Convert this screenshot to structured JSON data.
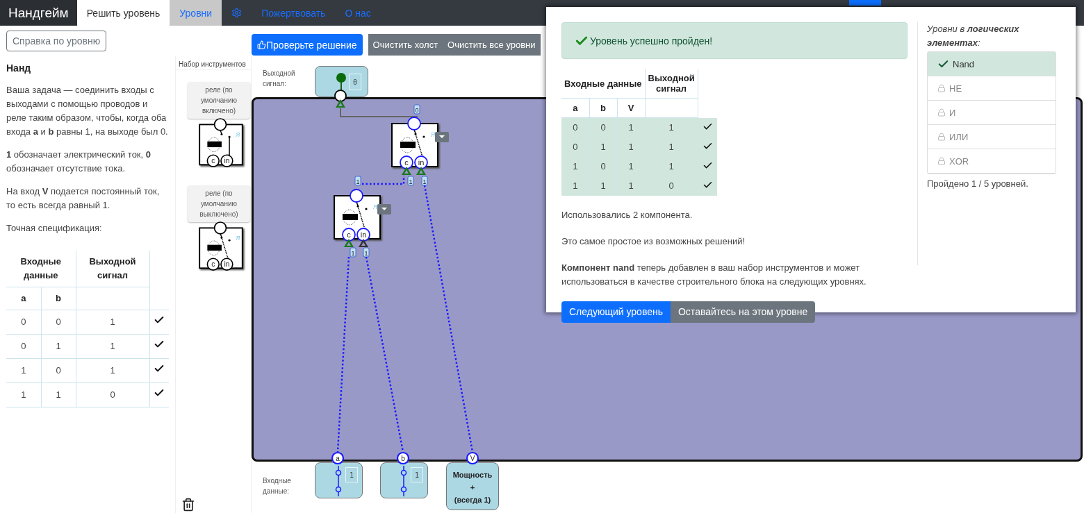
{
  "navbar": {
    "brand": "Нандгейм",
    "items": [
      {
        "kind": "text",
        "label": "Решить уровень",
        "selected": true,
        "highlighted": false
      },
      {
        "kind": "text",
        "label": "Уровни",
        "selected": false,
        "highlighted": true
      },
      {
        "kind": "settings",
        "selected": false,
        "highlighted": false
      },
      {
        "kind": "text",
        "label": "Пожертвовать",
        "selected": false,
        "highlighted": false
      },
      {
        "kind": "text",
        "label": "О нас",
        "selected": false,
        "highlighted": false
      },
      {
        "kind": "blank",
        "selected": true
      }
    ]
  },
  "sidebar": {
    "help_button": "Справка по уровню",
    "title": "Нанд",
    "paragraphs": [
      "Ваша задача — соединить входы с выходами с помощью проводов и реле таким образом, чтобы, когда оба входа **a** и **b** равны 1, на выходе был 0.",
      "**1** обозначает электрический ток, **0** обозначает отсутствие тока.",
      "На вход **V** подается постоянный ток, то есть всегда равный 1.",
      "Точная спецификация:"
    ],
    "spec_table": {
      "group_headers": [
        "Входные данные",
        "Выходной сигнал"
      ],
      "columns": [
        "a",
        "b"
      ],
      "rows": [
        {
          "cells": [
            "0",
            "0",
            "1"
          ],
          "passed": true
        },
        {
          "cells": [
            "0",
            "1",
            "1"
          ],
          "passed": true
        },
        {
          "cells": [
            "1",
            "0",
            "1"
          ],
          "passed": true
        },
        {
          "cells": [
            "1",
            "1",
            "0"
          ],
          "passed": true
        }
      ]
    }
  },
  "toolbar": {
    "check_button": "Проверьте решение",
    "buttons": [
      "Очистить холст",
      "Очистить все уровни"
    ]
  },
  "toolbox": {
    "title": "Набор инструментов",
    "items": [
      {
        "label": "реле (по умолчанию включено)",
        "default_on": true,
        "flip_mark": "Я",
        "pins": [
          "c",
          "in"
        ]
      },
      {
        "label": "реле (по умолчанию выключено)",
        "default_on": false,
        "flip_mark": "Я",
        "pins": [
          "c",
          "in"
        ]
      }
    ]
  },
  "circuit": {
    "output": {
      "label": "Выходной сигнал:",
      "lamp_on": true,
      "value": "0",
      "powered": true
    },
    "relays": [
      {
        "default_on": false,
        "flip_mark": "Я",
        "pins": [
          {
            "label": "c",
            "powered": true
          },
          {
            "label": "in",
            "powered": true
          }
        ]
      },
      {
        "default_on": false,
        "flip_mark": "Я",
        "pins": [
          {
            "label": "c",
            "powered": true
          },
          {
            "label": "in",
            "powered": false
          }
        ]
      }
    ],
    "wires": [
      {
        "value": "0",
        "active": false
      },
      {
        "value": "1",
        "end_value": "1",
        "active": true
      },
      {
        "value": "1",
        "active": true
      },
      {
        "value": "1",
        "active": true
      },
      {
        "value": "1",
        "active": true
      }
    ],
    "inputs_label": "Входные данные:",
    "inputs": [
      {
        "pin": "a",
        "value": "1",
        "on": true
      },
      {
        "pin": "b",
        "value": "1",
        "on": true
      }
    ],
    "power": {
      "pin": "V",
      "title": "Мощность",
      "plus": "+",
      "note": "(всегда 1)"
    }
  },
  "modal": {
    "alert": "Уровень успешно пройден!",
    "table": {
      "headers": [
        "Входные данные",
        "Выходной сигнал"
      ],
      "columns": [
        "a",
        "b",
        "V"
      ],
      "rows": [
        {
          "cells": [
            "0",
            "0",
            "1",
            "1"
          ],
          "passed": true
        },
        {
          "cells": [
            "0",
            "1",
            "1",
            "1"
          ],
          "passed": true
        },
        {
          "cells": [
            "1",
            "0",
            "1",
            "1"
          ],
          "passed": true
        },
        {
          "cells": [
            "1",
            "1",
            "1",
            "0"
          ],
          "passed": true
        }
      ]
    },
    "paragraphs": [
      "Использовались 2 компонента.",
      "Это самое простое из возможных решений!",
      "**Компонент nand** теперь добавлен в ваш набор инструментов и может использоваться в качестве строительного блока на следующих уровнях."
    ],
    "buttons": [
      "Следующий уровень",
      "Оставайтесь на этом уровне"
    ],
    "levels_title": "Уровни в **логических элементах**:",
    "levels": [
      {
        "label": "Nand",
        "selected": true,
        "locked": false
      },
      {
        "label": "НЕ",
        "selected": false,
        "locked": true
      },
      {
        "label": "И",
        "selected": false,
        "locked": true
      },
      {
        "label": "ИЛИ",
        "selected": false,
        "locked": true
      },
      {
        "label": "XOR",
        "selected": false,
        "locked": true
      }
    ],
    "progress": "Пройдено 1 / 5 уровней."
  }
}
